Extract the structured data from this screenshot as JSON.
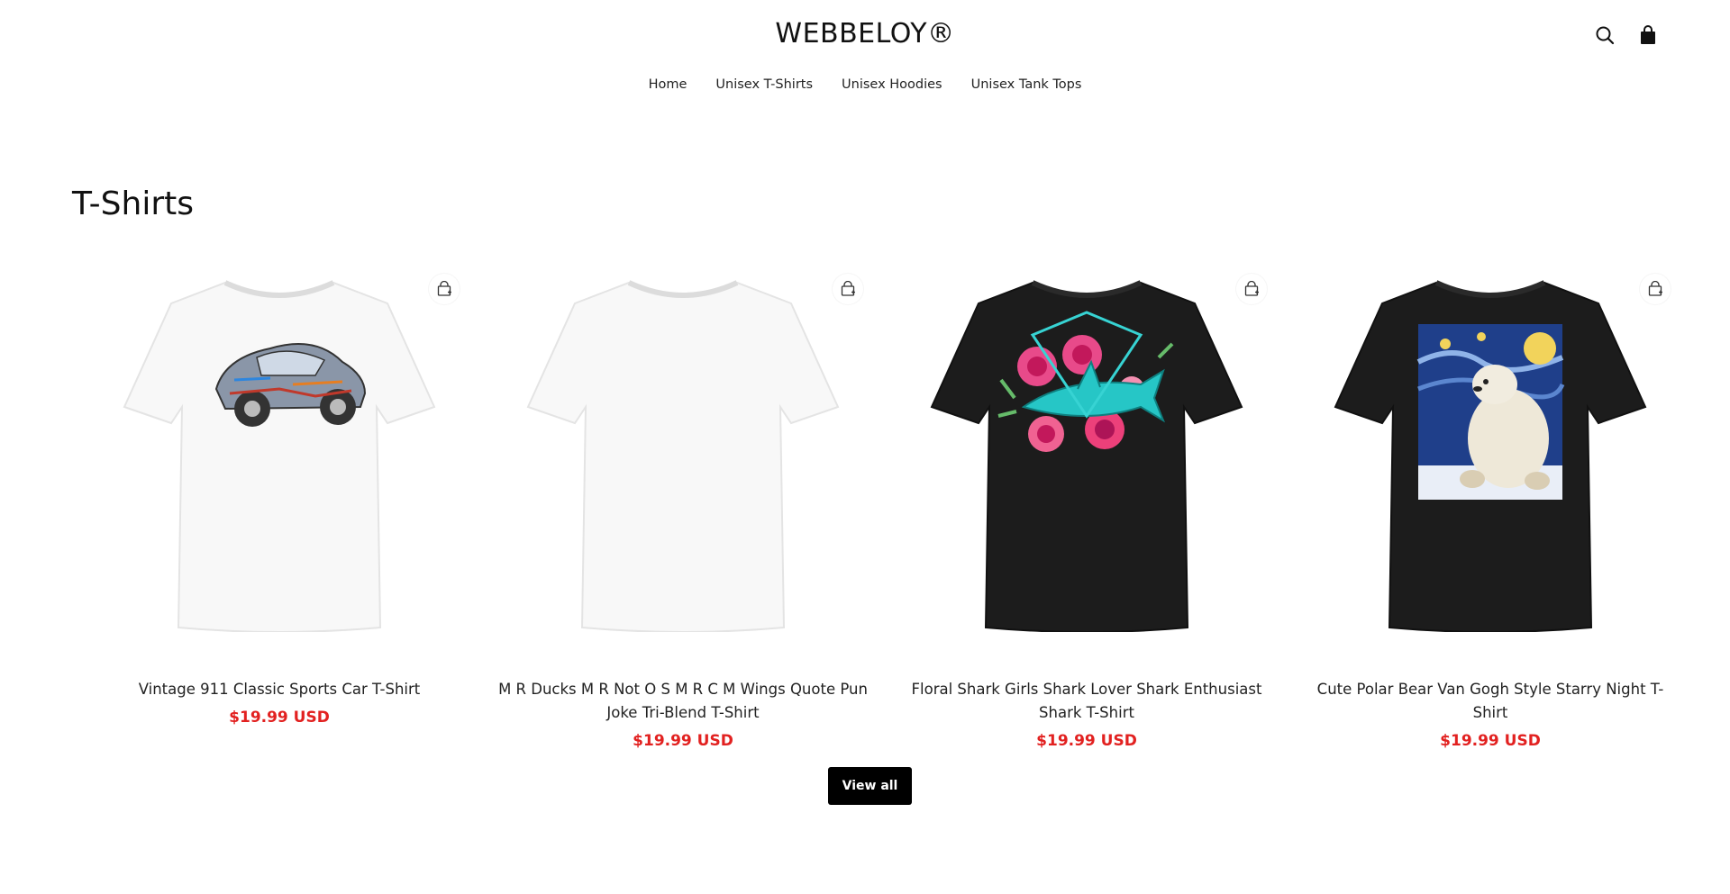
{
  "header": {
    "logo": "WEBBELOY®",
    "icons": [
      "search-icon",
      "shopping-bag-icon"
    ]
  },
  "nav": {
    "items": [
      {
        "label": "Home"
      },
      {
        "label": "Unisex T-Shirts"
      },
      {
        "label": "Unisex Hoodies"
      },
      {
        "label": "Unisex Tank Tops"
      }
    ]
  },
  "section": {
    "title": "T-Shirts"
  },
  "products": [
    {
      "title": "Vintage 911 Classic Sports Car T-Shirt",
      "price": "$19.99 USD",
      "shirt_color": "#f7f7f7",
      "graphic": "sports car"
    },
    {
      "title": "M R Ducks M R Not O S M R C M Wings Quote Pun Joke Tri-Blend T-Shirt",
      "price": "$19.99 USD",
      "shirt_color": "#f7f7f7",
      "graphic": "none"
    },
    {
      "title": "Floral Shark Girls Shark Lover Shark Enthusiast Shark T-Shirt",
      "price": "$19.99 USD",
      "shirt_color": "#1c1c1c",
      "graphic": "shark with pink flowers"
    },
    {
      "title": "Cute Polar Bear Van Gogh Style Starry Night T-Shirt",
      "price": "$19.99 USD",
      "shirt_color": "#1c1c1c",
      "graphic": "polar bear starry night"
    }
  ],
  "view_all": {
    "label": "View all"
  },
  "colors": {
    "price": "#e22120",
    "button_bg": "#000000",
    "button_text": "#ffffff"
  }
}
